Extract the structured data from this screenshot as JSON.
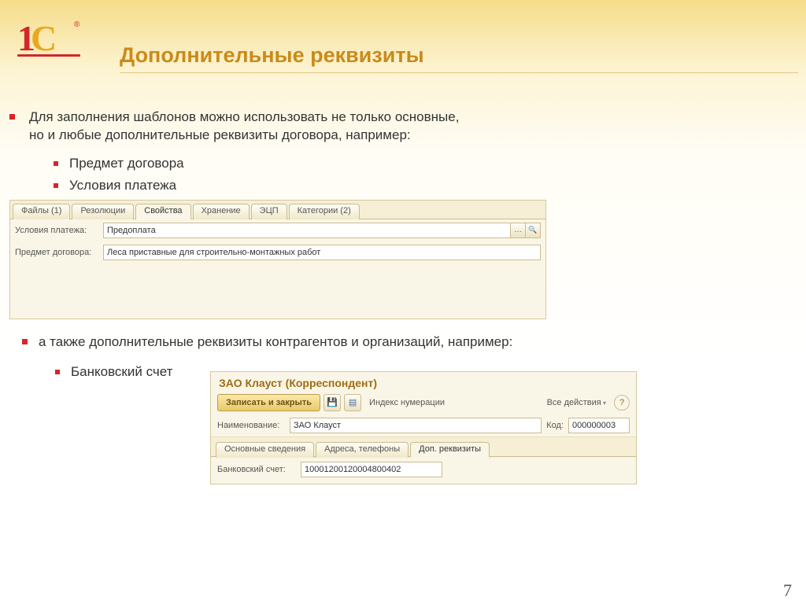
{
  "slide": {
    "title": "Дополнительные реквизиты",
    "page_number": "7"
  },
  "text": {
    "para1_line1": "Для заполнения шаблонов можно использовать не только основные,",
    "para1_line2": "но и любые дополнительные реквизиты договора, например:",
    "sub1_a": "Предмет договора",
    "sub1_b": "Условия платежа",
    "para2": "а также дополнительные реквизиты контрагентов и организаций, например:",
    "sub2_a": "Банковский счет"
  },
  "panel1": {
    "tabs": {
      "files": "Файлы (1)",
      "resolutions": "Резолюции",
      "properties": "Свойства",
      "storage": "Хранение",
      "edssign": "ЭЦП",
      "categories": "Категории (2)"
    },
    "row_payment_label": "Условия платежа:",
    "row_payment_value": "Предоплата",
    "row_subject_label": "Предмет договора:",
    "row_subject_value": "Леса приставные для строительно-монтажных работ"
  },
  "panel2": {
    "title": "ЗАО Клауст (Корреспондент)",
    "save_close": "Записать и закрыть",
    "index_num": "Индекс нумерации",
    "all_actions": "Все действия",
    "name_label": "Наименование:",
    "name_value": "ЗАО Клауст",
    "code_label": "Код:",
    "code_value": "000000003",
    "tabs": {
      "main": "Основные сведения",
      "addr": "Адреса, телефоны",
      "extra": "Доп. реквизиты"
    },
    "bank_label": "Банковский счет:",
    "bank_value": "10001200120004800402"
  }
}
